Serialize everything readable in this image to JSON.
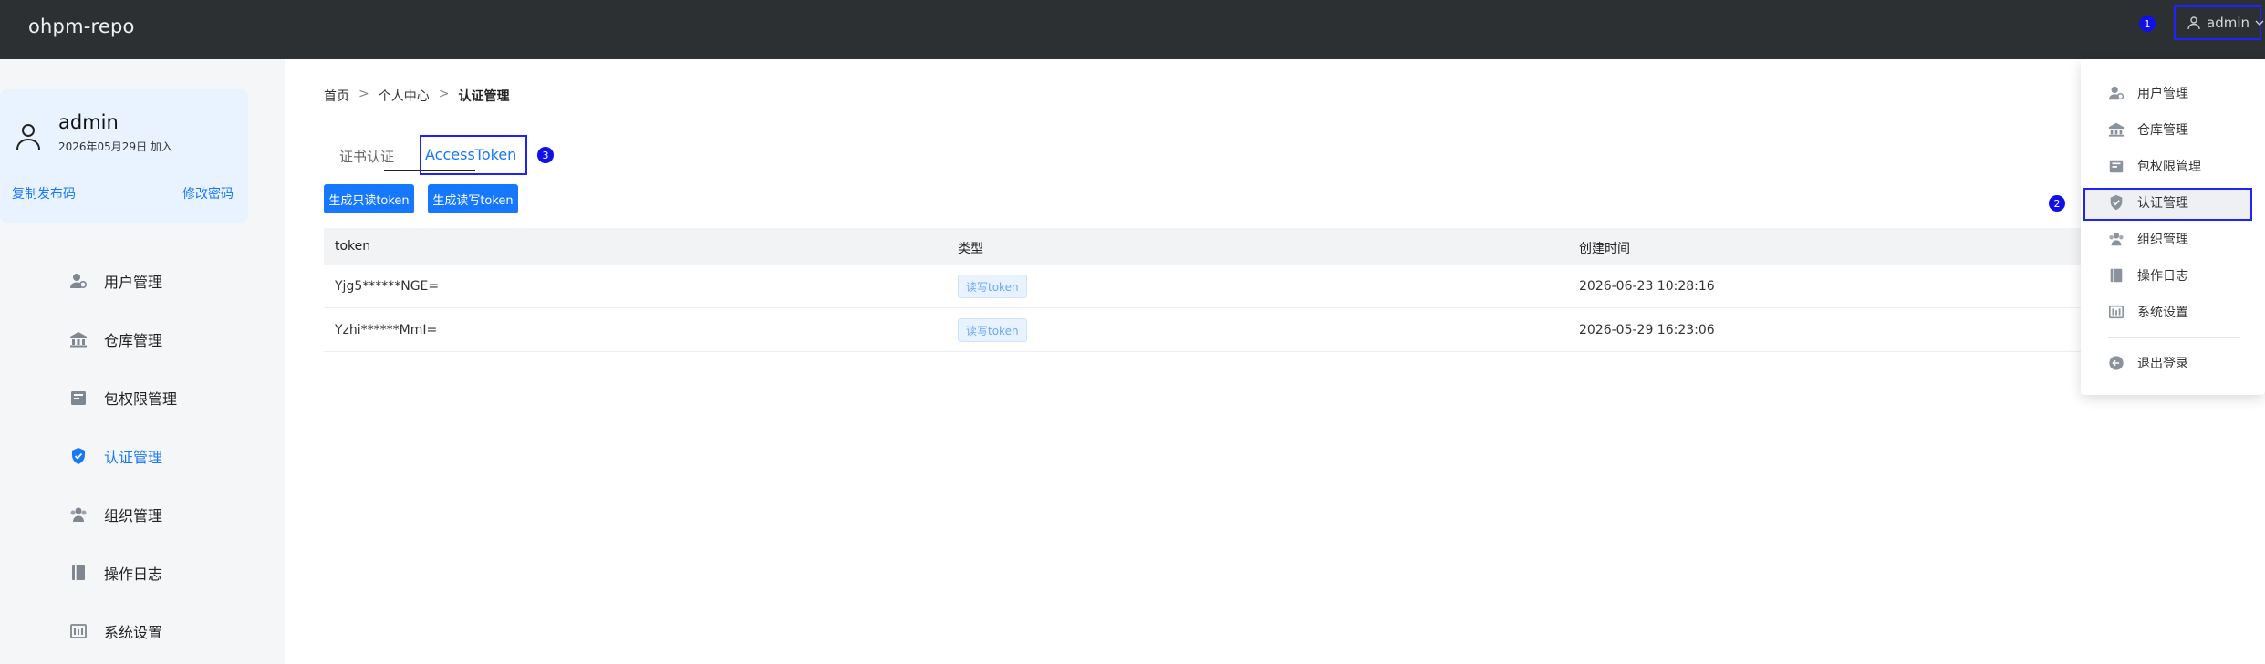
{
  "app": {
    "logo": "ohpm-repo"
  },
  "header": {
    "username": "admin",
    "user_icon": "user-icon",
    "chevron": "chevron-down-icon"
  },
  "badges": {
    "b1": "1",
    "b2": "2",
    "b3": "3"
  },
  "profile": {
    "name": "admin",
    "joined": "2026年05月29日 加入",
    "copy_link": "复制发布码",
    "change_password": "修改密码"
  },
  "sidebar": {
    "items": [
      {
        "label": "用户管理",
        "icon": "user-manage-icon"
      },
      {
        "label": "仓库管理",
        "icon": "warehouse-icon"
      },
      {
        "label": "包权限管理",
        "icon": "package-permission-icon"
      },
      {
        "label": "认证管理",
        "icon": "shield-icon",
        "active": true
      },
      {
        "label": "组织管理",
        "icon": "organization-icon"
      },
      {
        "label": "操作日志",
        "icon": "log-book-icon"
      },
      {
        "label": "系统设置",
        "icon": "settings-icon"
      }
    ]
  },
  "breadcrumb": {
    "home": "首页",
    "sep": ">",
    "center": "个人中心",
    "current": "认证管理"
  },
  "tabs": {
    "cert": "证书认证",
    "access": "AccessToken"
  },
  "buttons": {
    "readonly": "生成只读token",
    "readwrite": "生成读写token"
  },
  "table": {
    "headers": {
      "token": "token",
      "type": "类型",
      "created": "创建时间"
    },
    "rows": [
      {
        "token": "Yjg5******NGE=",
        "type": "读写token",
        "created": "2026-06-23 10:28:16"
      },
      {
        "token": "Yzhi******MmI=",
        "type": "读写token",
        "created": "2026-05-29 16:23:06"
      }
    ]
  },
  "dropdown": {
    "items": [
      {
        "label": "用户管理"
      },
      {
        "label": "仓库管理"
      },
      {
        "label": "包权限管理"
      },
      {
        "label": "认证管理",
        "highlighted": true
      },
      {
        "label": "组织管理"
      },
      {
        "label": "操作日志"
      },
      {
        "label": "系统设置"
      }
    ],
    "logout": "退出登录"
  },
  "colors": {
    "accent": "#1677ff",
    "topbar": "#2c3033",
    "highlight_box": "#1e22ff"
  }
}
